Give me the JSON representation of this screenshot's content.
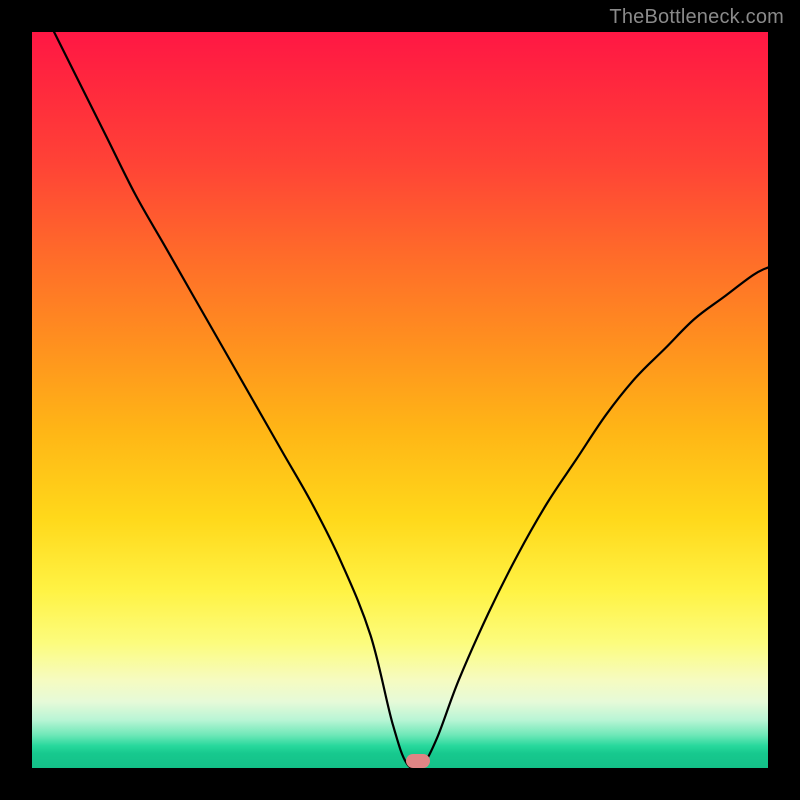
{
  "watermark": {
    "text": "TheBottleneck.com"
  },
  "marker": {
    "color": "#e08585",
    "x_pct": 52.5,
    "y_pct": 99.0
  },
  "chart_data": {
    "type": "line",
    "title": "",
    "xlabel": "",
    "ylabel": "",
    "xlim": [
      0,
      100
    ],
    "ylim": [
      0,
      100
    ],
    "grid": false,
    "legend": false,
    "background_gradient": {
      "direction": "vertical",
      "stops": [
        {
          "pos": 0.0,
          "color": "#ff1744"
        },
        {
          "pos": 0.08,
          "color": "#ff2a3d"
        },
        {
          "pos": 0.18,
          "color": "#ff4336"
        },
        {
          "pos": 0.3,
          "color": "#ff6a2a"
        },
        {
          "pos": 0.42,
          "color": "#ff8f1f"
        },
        {
          "pos": 0.54,
          "color": "#ffb516"
        },
        {
          "pos": 0.66,
          "color": "#ffd81a"
        },
        {
          "pos": 0.76,
          "color": "#fff345"
        },
        {
          "pos": 0.83,
          "color": "#fcfc7d"
        },
        {
          "pos": 0.88,
          "color": "#f6fbc0"
        },
        {
          "pos": 0.91,
          "color": "#e6fad8"
        },
        {
          "pos": 0.935,
          "color": "#b8f5d5"
        },
        {
          "pos": 0.955,
          "color": "#6fe8b8"
        },
        {
          "pos": 0.97,
          "color": "#27d89c"
        },
        {
          "pos": 0.98,
          "color": "#17c98e"
        },
        {
          "pos": 1.0,
          "color": "#13c088"
        }
      ]
    },
    "marker_point": {
      "x": 52.5,
      "y": 0
    },
    "series": [
      {
        "name": "bottleneck-curve",
        "color": "#000000",
        "x": [
          3,
          6,
          10,
          14,
          18,
          22,
          26,
          30,
          34,
          38,
          42,
          46,
          49,
          51,
          53,
          55,
          58,
          62,
          66,
          70,
          74,
          78,
          82,
          86,
          90,
          94,
          98,
          100
        ],
        "y": [
          100,
          94,
          86,
          78,
          71,
          64,
          57,
          50,
          43,
          36,
          28,
          18,
          6,
          0.5,
          0.5,
          4,
          12,
          21,
          29,
          36,
          42,
          48,
          53,
          57,
          61,
          64,
          67,
          68
        ]
      }
    ]
  }
}
